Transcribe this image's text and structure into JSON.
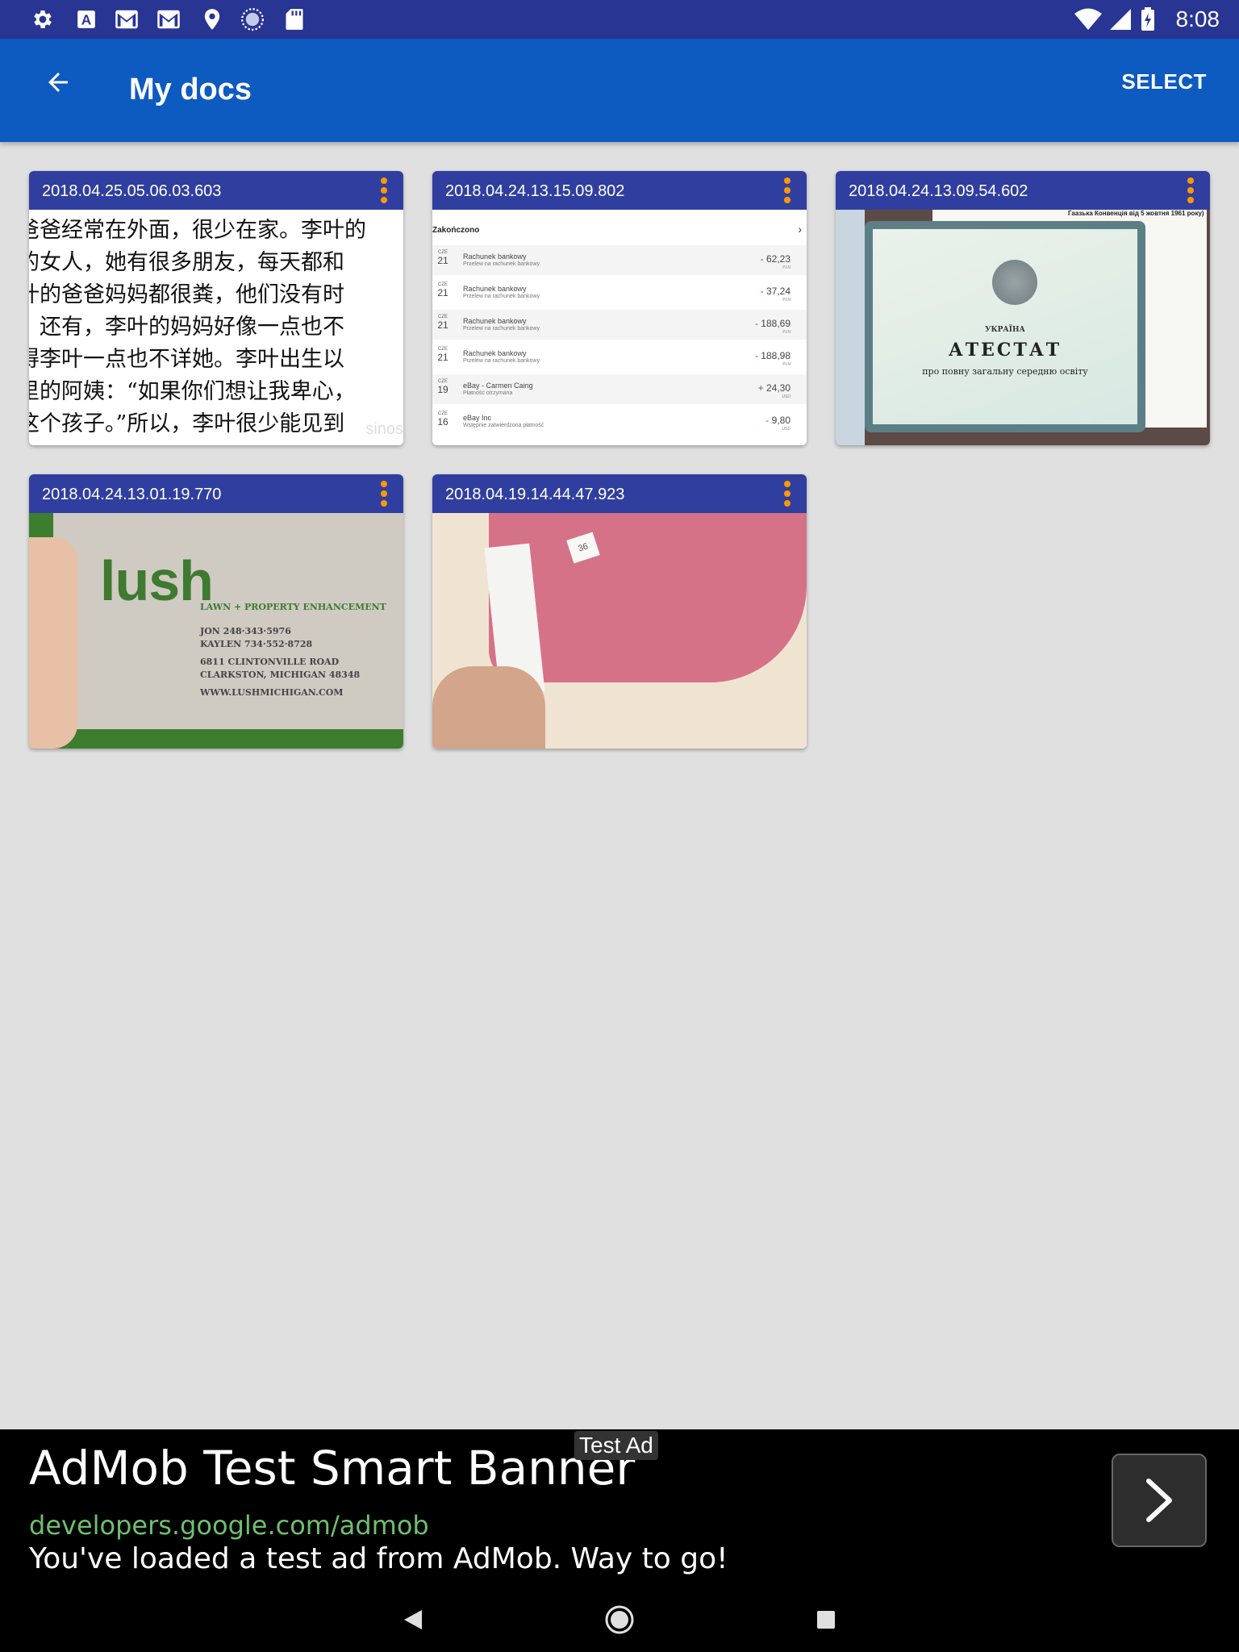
{
  "status_bar": {
    "time": "8:08",
    "left_icons": [
      "settings-icon",
      "font-a-icon",
      "gmail-icon",
      "gmail-icon",
      "location-icon",
      "sync-icon",
      "sd-card-icon"
    ],
    "right_icons": [
      "wifi-icon",
      "signal-icon",
      "battery-icon"
    ]
  },
  "app_bar": {
    "title": "My docs",
    "select_label": "SELECT"
  },
  "documents": [
    {
      "date": "2018.04.25.05.06.03.603",
      "thumbnail": "chinese-text"
    },
    {
      "date": "2018.04.24.13.15.09.802",
      "thumbnail": "bank-transactions"
    },
    {
      "date": "2018.04.24.13.09.54.602",
      "thumbnail": "certificate"
    },
    {
      "date": "2018.04.24.13.01.19.770",
      "thumbnail": "business-card"
    },
    {
      "date": "2018.04.19.14.44.47.923",
      "thumbnail": "sweater-label"
    }
  ],
  "thumb_text": {
    "lines": [
      "爸爸经常在外面，很少在家。李叶的",
      "的女人，她有很多朋友，每天都和",
      "叶的爸爸妈妈都很粪，他们没有时",
      "。还有，李叶的妈妈好像一点也不",
      "得李叶一点也不详她。李叶出生以",
      "里的阿姨：“如果你们想让我卑心，",
      "这个孩子。”所以，李叶很少能见到"
    ],
    "watermark": "sinos"
  },
  "thumb_tx": {
    "header": "Zakończono",
    "rows": [
      {
        "month": "CZE",
        "day": "21",
        "title": "Rachunek bankowy",
        "subtitle": "Przelew na rachunek bankowy",
        "amount": "62,23",
        "currency": "PLN",
        "sign": "neg"
      },
      {
        "month": "CZE",
        "day": "21",
        "title": "Rachunek bankowy",
        "subtitle": "Przelew na rachunek bankowy",
        "amount": "37,24",
        "currency": "PLN",
        "sign": "neg"
      },
      {
        "month": "CZE",
        "day": "21",
        "title": "Rachunek bankowy",
        "subtitle": "Przelew na rachunek bankowy",
        "amount": "188,69",
        "currency": "PLN",
        "sign": "neg"
      },
      {
        "month": "CZE",
        "day": "21",
        "title": "Rachunek bankowy",
        "subtitle": "Przelew na rachunek bankowy",
        "amount": "188,98",
        "currency": "PLN",
        "sign": "neg"
      },
      {
        "month": "CZE",
        "day": "19",
        "title": "eBay - Carmen Caing",
        "subtitle": "Płatność otrzymana",
        "amount": "24,30",
        "currency": "USD",
        "sign": "pos"
      },
      {
        "month": "CZE",
        "day": "16",
        "title": "eBay Inc",
        "subtitle": "Wstępnie zatwierdzona płatność",
        "amount": "9,80",
        "currency": "USD",
        "sign": "neg"
      }
    ]
  },
  "thumb_cert": {
    "top_text": "Гаазька Конвенція від 5 жовтня 1961 року)",
    "country": "УКРАЇНА",
    "title": "АТЕСТАТ",
    "subtitle": "про повну загальну середню освіту"
  },
  "thumb_biz": {
    "logo": "lush",
    "tagline": "LAWN + PROPERTY ENHANCEMENT",
    "lines": [
      "JON  248·343·5976",
      "KAYLEN  734·552·8728",
      "6811 CLINTONVILLE ROAD",
      "CLARKSTON, MICHIGAN 48348",
      "WWW.LUSHMICHIGAN.COM"
    ]
  },
  "thumb_sweater": {
    "size_tag": "36"
  },
  "ad": {
    "badge": "Test Ad",
    "title": "AdMob Test Smart Banner",
    "url": "developers.google.com/admob",
    "description": "You've loaded a test ad from AdMob. Way to go!"
  },
  "nav": [
    "back-triangle-icon",
    "home-circle-icon",
    "recents-square-icon"
  ],
  "colors": {
    "status_bar": "#283593",
    "app_bar": "#0d5ac1",
    "card_header": "#303f9f",
    "menu_dots": "#ff9800",
    "background": "#e0e0e0"
  }
}
